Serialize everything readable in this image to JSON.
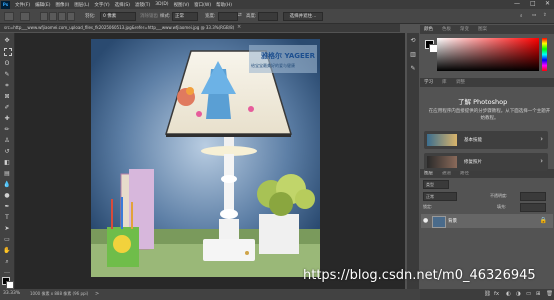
{
  "menubar": {
    "logo": "Ps",
    "items": [
      "文件(F)",
      "编辑(E)",
      "图像(I)",
      "图层(L)",
      "文字(Y)",
      "选择(S)",
      "滤镜(T)",
      "3D(D)",
      "视图(V)",
      "窗口(W)",
      "帮助(H)"
    ],
    "minimize": "—",
    "maximize": "□",
    "close": "✕"
  },
  "options": {
    "feather_label": "羽化:",
    "feather_value": "0 像素",
    "antialias_label": "消除锯齿",
    "style_label": "样式:",
    "style_value": "正常",
    "width_label": "宽度:",
    "height_label": "高度:",
    "select_mask_button": "选择并遮住..."
  },
  "document": {
    "tab_title": "src=http___www.wfjiaomei.com_upload_files_fk2025060513.jpg&refer=http___www.wfjiaomei.jpg @ 33.3%(RGB/8)",
    "photo_caption_cn": "雅格尔",
    "photo_caption_en": "YAGEER",
    "photo_subcaption": "给宝宝最美好的爱与健康"
  },
  "statusbar": {
    "zoom": "33.33%",
    "doc_info": "1000 像素 x 888 像素 (96 ppi)",
    "arrow": ">"
  },
  "panels": {
    "color_tabs": [
      "颜色",
      "色板",
      "渐变",
      "图案"
    ],
    "learn_tabs": [
      "学习",
      "库",
      "调整"
    ],
    "learn_title": "了解 Photoshop",
    "learn_desc": "在应用程序内直接提供的分步骤教程。从下面选择一个主题开始教程。",
    "cards": [
      {
        "label": "基本技能",
        "arrow": "›"
      },
      {
        "label": "修复照片",
        "arrow": "›"
      }
    ],
    "layers_tabs": [
      "图层",
      "通道",
      "路径"
    ],
    "layer_kind": "类型",
    "layer_blend": "正常",
    "layer_opacity": "不透明度:",
    "layer_lock": "锁定:",
    "layer_fill": "填充:",
    "layer_name": "背景",
    "layer_eye": "●",
    "layer_lock_icon": "🔒"
  },
  "watermark": "https://blog.csdn.net/m0_46326945",
  "colors": {
    "menubar_bg": "#3c3c3c",
    "panel_bg": "#535353",
    "canvas_bg": "#282828",
    "accent_blue": "#31a8ff"
  }
}
